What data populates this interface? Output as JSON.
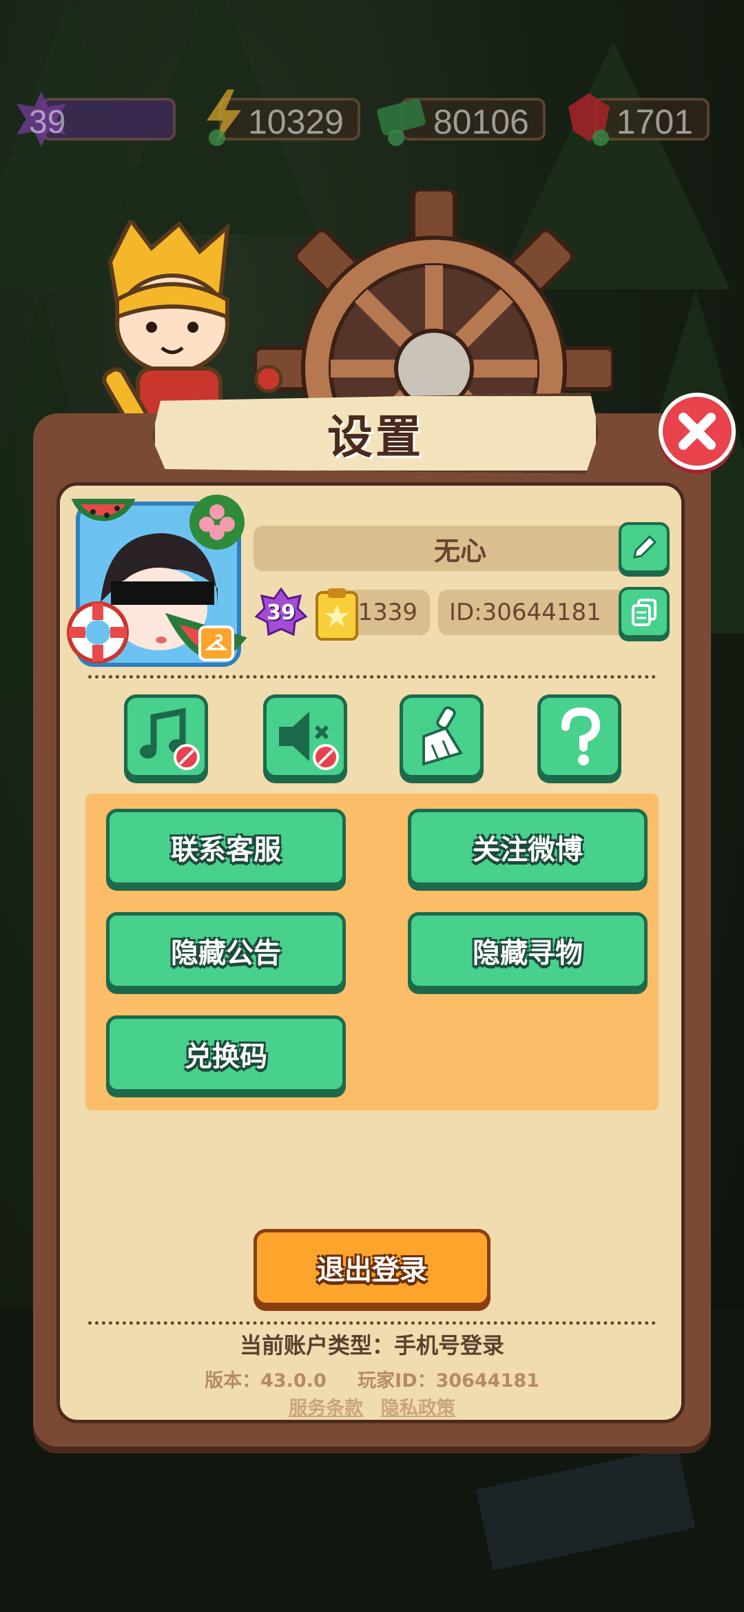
{
  "topbar": {
    "level": "39",
    "energy": "10329",
    "cash": "80106",
    "gems": "1701"
  },
  "dialog": {
    "title": "设置"
  },
  "profile": {
    "nickname": "无心",
    "level": "39",
    "stars": "1339",
    "id_text": "ID:30644181"
  },
  "settings_icons": [
    "music-off-icon",
    "sound-off-icon",
    "broom-icon",
    "question-icon"
  ],
  "actions": {
    "contact_service": "联系客服",
    "follow_weibo": "关注微博",
    "hide_notice": "隐藏公告",
    "hide_search": "隐藏寻物",
    "redeem_code": "兑换码"
  },
  "logout_label": "退出登录",
  "footer": {
    "account_type": "当前账户类型：手机号登录",
    "version": "版本：43.0.0",
    "player_id": "玩家ID：30644181",
    "terms": "服务条款",
    "privacy": "隐私政策"
  },
  "colors": {
    "button_green": "#48d08d",
    "panel_brown": "#7a4a35",
    "panel_cream": "#f0dcae",
    "action_orange": "#fbbd68",
    "logout_orange": "#fda42c",
    "close_red": "#e8424d"
  }
}
